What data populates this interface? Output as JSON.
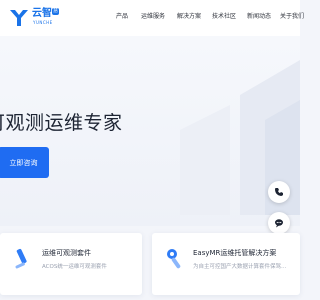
{
  "brand": {
    "name": "云智",
    "badge": "慧",
    "subtitle": "YUNCHE"
  },
  "nav": {
    "items": [
      {
        "label": "产品"
      },
      {
        "label": "运维服务"
      },
      {
        "label": "解决方案"
      },
      {
        "label": "技术社区"
      },
      {
        "label": "新闻动态"
      },
      {
        "label": "关于我们"
      }
    ]
  },
  "hero": {
    "title": "可观测运维专家",
    "cta_label": "立即咨询"
  },
  "floating": {
    "phone_icon": "phone-icon",
    "chat_icon": "chat-icon"
  },
  "cards": [
    {
      "title": "运维可观测套件",
      "desc": "ACOS统一运维可观测套件",
      "icon": "pen-icon"
    },
    {
      "title": "EasyMR运维托管解决方案",
      "desc": "为自主可控国产大数据计算套件保驾…",
      "icon": "tool-icon"
    }
  ],
  "colors": {
    "accent": "#1f6cf2",
    "brand": "#1a73e8",
    "text": "#1d2433"
  }
}
